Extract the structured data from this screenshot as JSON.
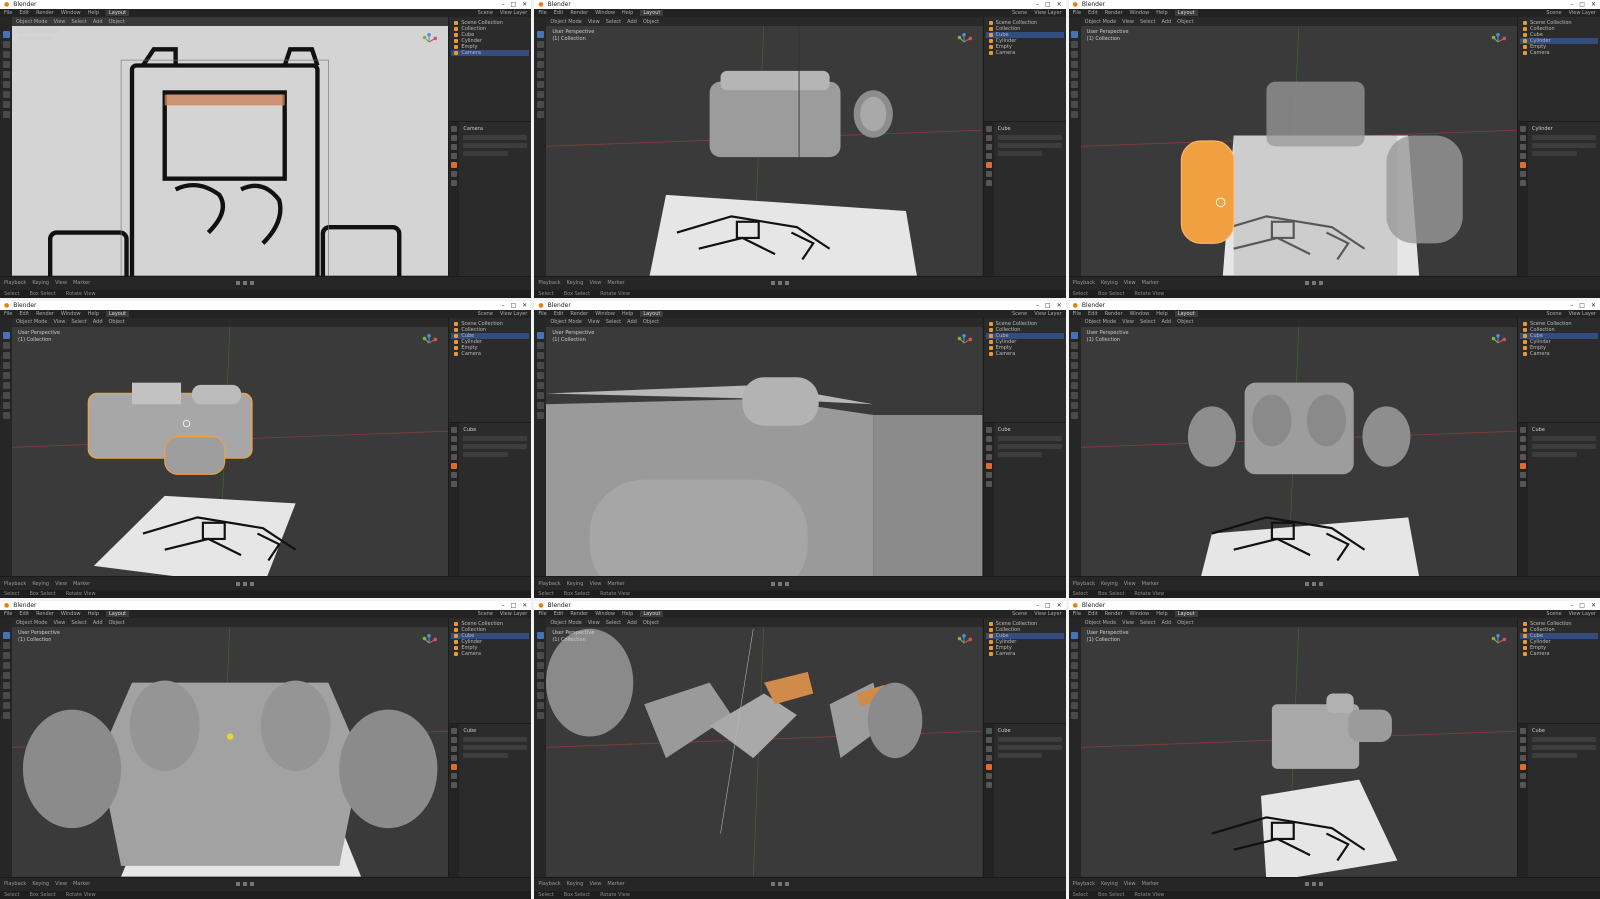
{
  "app_title": "Blender",
  "menus": [
    "File",
    "Edit",
    "Render",
    "Window",
    "Help"
  ],
  "workspace": "Layout",
  "view_layer": "View Layer",
  "scene_label": "Scene",
  "viewport_header": [
    "Object Mode",
    "View",
    "Select",
    "Add",
    "Object"
  ],
  "viewport_info": [
    "User Perspective",
    "(1) Collection"
  ],
  "outliner_rows": [
    "Scene Collection",
    "Collection",
    "Cube",
    "Cylinder",
    "Empty",
    "Camera"
  ],
  "timeline": [
    "Playback",
    "Keying",
    "View",
    "Marker"
  ],
  "status": [
    "Select",
    "Box Select",
    "Rotate View"
  ],
  "colors": {
    "selected_orange": "#f0a040",
    "active_blue": "#4772b3",
    "viewport_bg": "#3a3a3a"
  },
  "panels": [
    {
      "view": "sketch-reference",
      "active_object": "Camera"
    },
    {
      "view": "box-with-side-cylinder",
      "active_object": "Cube"
    },
    {
      "view": "ghosted-with-selected-cylinder",
      "active_object": "Cylinder"
    },
    {
      "view": "box-selected-orange",
      "active_object": "Cube"
    },
    {
      "view": "closeup",
      "active_object": "Cube"
    },
    {
      "view": "four-cylinders",
      "active_object": "Cube"
    },
    {
      "view": "closeup-front",
      "active_object": "Cube"
    },
    {
      "view": "wireframe-cut-shapes",
      "active_object": "Cube"
    },
    {
      "view": "final-small",
      "active_object": "Cube"
    }
  ]
}
